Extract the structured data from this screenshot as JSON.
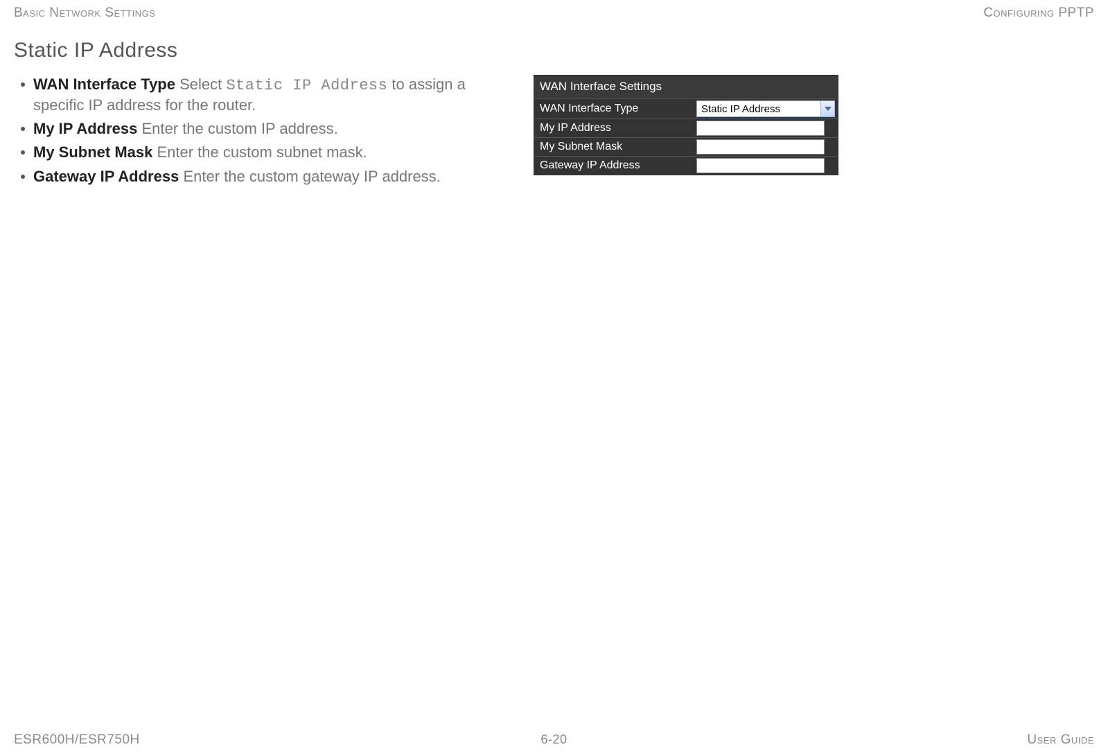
{
  "header": {
    "left": "Basic Network Settings",
    "right": "Configuring PPTP"
  },
  "section_title": "Static IP Address",
  "bullets": [
    {
      "term": "WAN Interface Type",
      "pre": "  Select ",
      "code": "Static IP Address",
      "post": " to assign a specific IP address for the router."
    },
    {
      "term": "My IP Address",
      "pre": "  Enter the custom IP address.",
      "code": "",
      "post": ""
    },
    {
      "term": "My Subnet Mask",
      "pre": "  Enter the custom subnet mask.",
      "code": "",
      "post": ""
    },
    {
      "term": "Gateway IP Address",
      "pre": "  Enter the custom gateway IP address.",
      "code": "",
      "post": ""
    }
  ],
  "panel": {
    "title": "WAN Interface Settings",
    "rows": {
      "r0": {
        "label": "WAN Interface Type",
        "value": "Static IP Address"
      },
      "r1": {
        "label": "My IP Address",
        "value": ""
      },
      "r2": {
        "label": "My Subnet Mask",
        "value": ""
      },
      "r3": {
        "label": "Gateway IP Address",
        "value": ""
      }
    }
  },
  "footer": {
    "left": "ESR600H/ESR750H",
    "center": "6-20",
    "right": "User Guide"
  }
}
